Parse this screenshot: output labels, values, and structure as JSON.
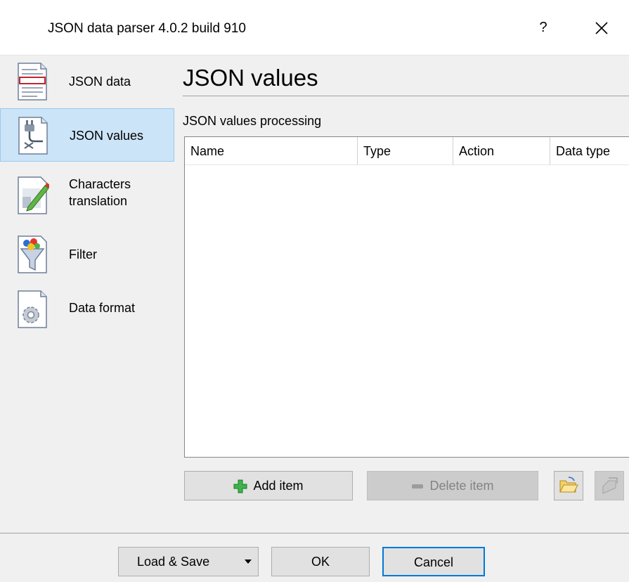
{
  "window": {
    "title": "JSON data parser 4.0.2 build 910",
    "help_label": "?"
  },
  "nav": {
    "items": [
      {
        "label": "JSON data",
        "icon": "document-lines-icon",
        "active": false
      },
      {
        "label": "JSON values",
        "icon": "document-plug-icon",
        "active": true
      },
      {
        "label": "Characters translation",
        "icon": "document-pencil-icon",
        "active": false
      },
      {
        "label": "Filter",
        "icon": "funnel-icon",
        "active": false
      },
      {
        "label": "Data format",
        "icon": "document-gear-icon",
        "active": false
      }
    ]
  },
  "main": {
    "title": "JSON values",
    "section_label": "JSON values processing",
    "columns": [
      "Name",
      "Type",
      "Action",
      "Data type"
    ],
    "add_item_label": "Add item",
    "delete_item_label": "Delete item"
  },
  "footer": {
    "load_save_label": "Load & Save",
    "ok_label": "OK",
    "cancel_label": "Cancel"
  },
  "colors": {
    "accent": "#0078d7",
    "active_nav_bg": "#cce4f7",
    "add_icon": "#3cb44b"
  }
}
